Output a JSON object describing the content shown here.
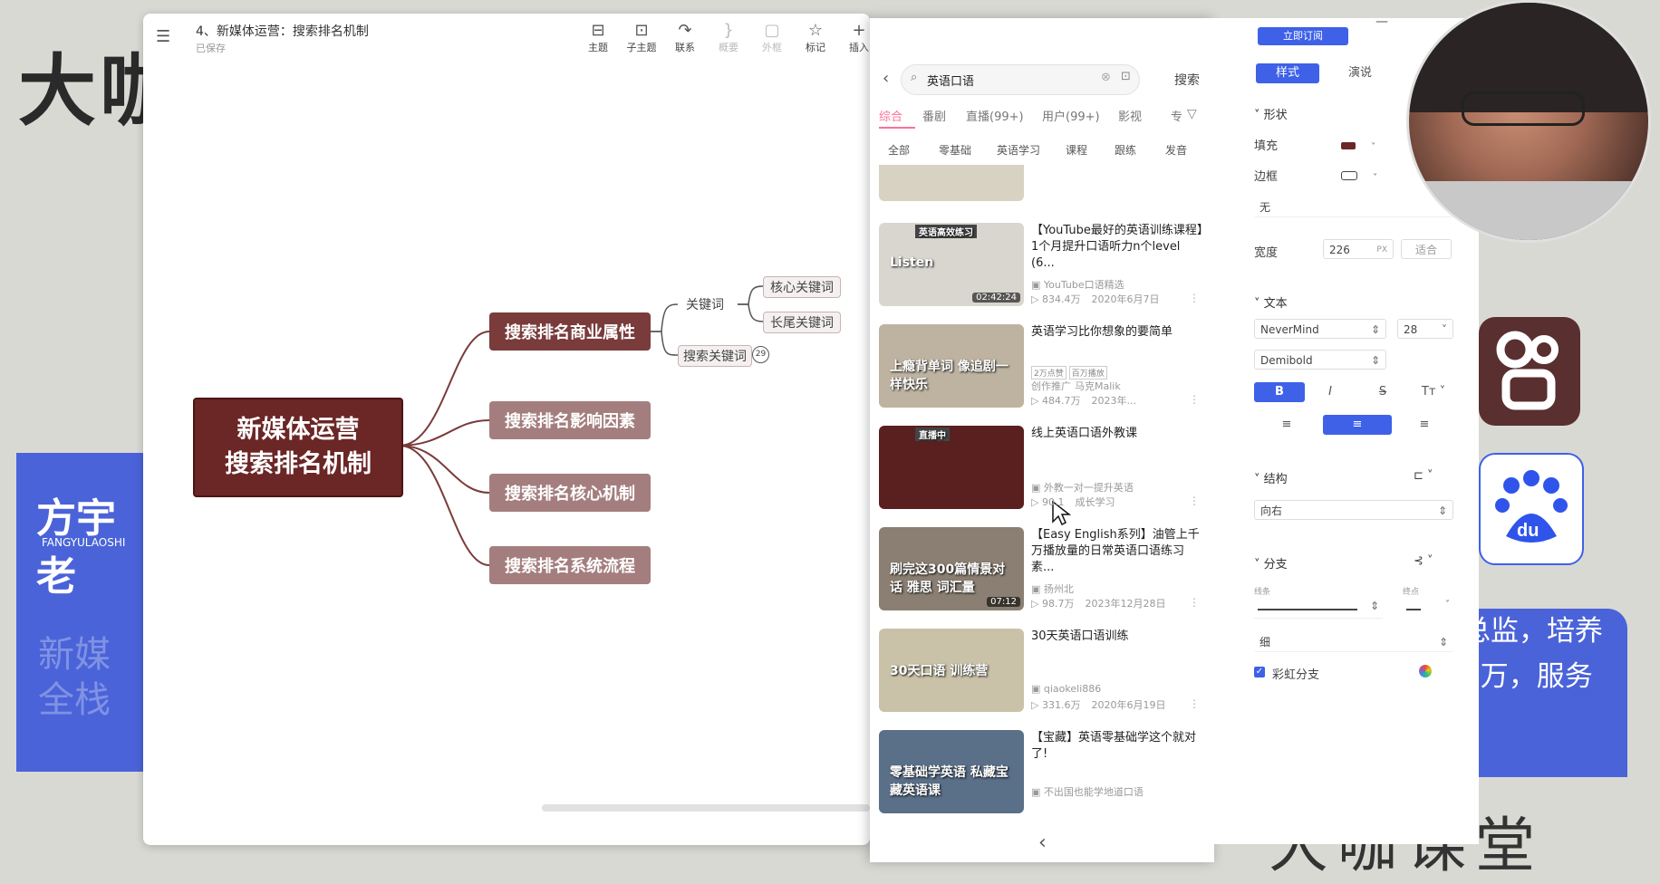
{
  "background": {
    "brand": "大咖",
    "left_card_name": "方宇老",
    "left_card_sub": "FANGYULAOSHI",
    "left_card_faint1": "新媒",
    "left_card_faint2": "全栈",
    "right_card_line1": "总监，培养",
    "right_card_line2": "0万，服务",
    "bottom_logo": "大咖课堂"
  },
  "mindmap": {
    "title": "4、新媒体运营：搜索排名机制",
    "saved": "已保存",
    "toolbar": [
      {
        "label": "主题",
        "icon": "topic-icon",
        "glyph": "⊟",
        "enabled": true
      },
      {
        "label": "子主题",
        "icon": "subtopic-icon",
        "glyph": "⊡",
        "enabled": true
      },
      {
        "label": "联系",
        "icon": "relation-icon",
        "glyph": "↷",
        "enabled": true
      },
      {
        "label": "概要",
        "icon": "summary-icon",
        "glyph": "}",
        "enabled": false
      },
      {
        "label": "外框",
        "icon": "boundary-icon",
        "glyph": "▢",
        "enabled": false
      },
      {
        "label": "标记",
        "icon": "marker-icon",
        "glyph": "☆",
        "enabled": true
      },
      {
        "label": "插入",
        "icon": "insert-icon",
        "glyph": "+",
        "enabled": true
      }
    ],
    "format_label": "样式",
    "root": [
      "新媒体运营",
      "搜索排名机制"
    ],
    "branches": [
      "搜索排名商业属性",
      "搜索排名影响因素",
      "搜索排名核心机制",
      "搜索排名系统流程"
    ],
    "sub_keyword": "关键词",
    "sub_search_keyword": "搜索关键词",
    "sub_search_keyword_badge": "29",
    "leaf_core": "核心关键词",
    "leaf_long": "长尾关键词"
  },
  "bili": {
    "search_value": "英语口语",
    "search_button": "搜索",
    "tabs": [
      "综合",
      "番剧",
      "直播(99+)",
      "用户(99+)",
      "影视",
      "专"
    ],
    "filters": [
      "全部",
      "零基础",
      "英语学习",
      "课程",
      "跟练",
      "发音"
    ],
    "videos": [
      {
        "title": "【YouTube最好的英语训练课程】1个月提升口语听力n个level (6...",
        "up": "YouTube口语精选",
        "views": "834.4万",
        "date": "2020年6月7日",
        "thumb_text": "Listen",
        "thumb_badge": "英语高效练习",
        "duration": "02:42:24",
        "thumb_color": "#d9d6cf"
      },
      {
        "title": "英语学习比你想象的要简单",
        "up": "马克Malik",
        "up_prefix": "创作推广",
        "tags": [
          "2万点赞",
          "百万播放"
        ],
        "views": "484.7万",
        "date": "2023年...",
        "thumb_text": "上瘾背单词 像追剧一样快乐",
        "duration": "",
        "thumb_color": "#bdb3a0"
      },
      {
        "title": "线上英语口语外教课",
        "up": "外教一对一提升英语",
        "views": "90.1",
        "date": "成长学习",
        "thumb_text": "",
        "thumb_badge": "直播中",
        "duration": "",
        "thumb_color": "#5a2020"
      },
      {
        "title": "【Easy English系列】油管上千万播放量的日常英语口语练习素...",
        "up": "扬州北",
        "views": "98.7万",
        "date": "2023年12月28日",
        "thumb_text": "刷完这300篇情景对话 雅思 词汇量",
        "duration": "07:12",
        "thumb_color": "#8a7f72"
      },
      {
        "title": "30天英语口语训练",
        "up": "qiaokeli886",
        "views": "331.6万",
        "date": "2020年6月19日",
        "thumb_text": "30天口语 训练营",
        "duration": "",
        "thumb_color": "#c9c2a8"
      },
      {
        "title": "【宝藏】英语零基础学这个就对了!",
        "up": "不出国也能学地道口语",
        "views": "",
        "date": "",
        "thumb_text": "零基础学英语 私藏宝藏英语课",
        "duration": "",
        "thumb_color": "#5a6f88"
      }
    ]
  },
  "props": {
    "subscribe": "立即订阅",
    "tabs": [
      "样式",
      "演说"
    ],
    "shape_section": "形状",
    "fill_label": "填充",
    "border_label": "边框",
    "none_option": "无",
    "width_label": "宽度",
    "width_value": "226",
    "width_unit": "PX",
    "fit_label": "适合",
    "text_section": "文本",
    "font": "NeverMind",
    "font_size": "28",
    "font_weight": "Demibold",
    "structure_section": "结构",
    "structure_value": "向右",
    "branch_section": "分支",
    "line_label": "线条",
    "end_label": "终点",
    "thickness": "细",
    "rainbow_label": "彩虹分支",
    "accent": "#3e61e8"
  }
}
